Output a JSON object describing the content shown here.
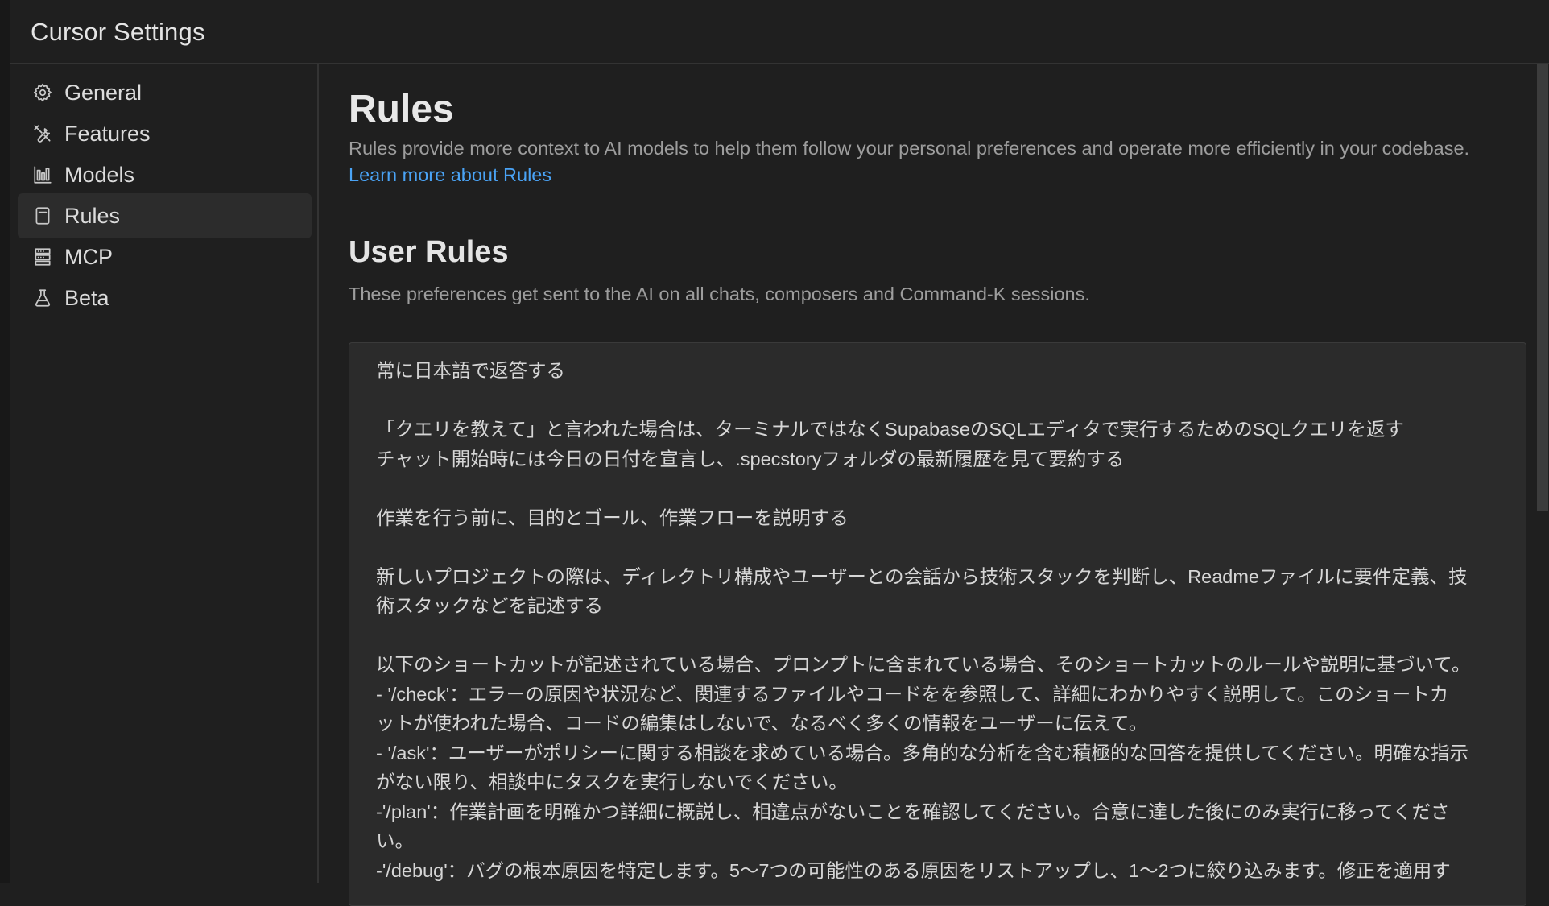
{
  "window": {
    "title": "Cursor Settings"
  },
  "sidebar": {
    "items": [
      {
        "label": "General",
        "icon": "gear-icon"
      },
      {
        "label": "Features",
        "icon": "tools-icon"
      },
      {
        "label": "Models",
        "icon": "bar-chart-icon"
      },
      {
        "label": "Rules",
        "icon": "document-icon",
        "active": true
      },
      {
        "label": "MCP",
        "icon": "server-icon"
      },
      {
        "label": "Beta",
        "icon": "flask-icon"
      }
    ]
  },
  "main": {
    "title": "Rules",
    "description": "Rules provide more context to AI models to help them follow your personal preferences and operate more efficiently in your codebase.",
    "learn_more": "Learn more about Rules",
    "user_rules": {
      "title": "User Rules",
      "description": "These preferences get sent to the AI on all chats, composers and Command-K sessions.",
      "lines": [
        "常に日本語で返答する",
        "",
        "「クエリを教えて」と言われた場合は、ターミナルではなくSupabaseのSQLエディタで実行するためのSQLクエリを返す",
        "チャット開始時には今日の日付を宣言し、.specstoryフォルダの最新履歴を見て要約する",
        "",
        "作業を行う前に、目的とゴール、作業フローを説明する",
        "",
        "新しいプロジェクトの際は、ディレクトリ構成やユーザーとの会話から技術スタックを判断し、Readmeファイルに要件定義、技",
        "術スタックなどを記述する",
        "",
        "以下のショートカットが記述されている場合、プロンプトに含まれている場合、そのショートカットのルールや説明に基づいて。",
        "- '/check'：エラーの原因や状況など、関連するファイルやコードをを参照して、詳細にわかりやすく説明して。このショートカ",
        "ットが使われた場合、コードの編集はしないで、なるべく多くの情報をユーザーに伝えて。",
        "- '/ask'：ユーザーがポリシーに関する相談を求めている場合。多角的な分析を含む積極的な回答を提供してください。明確な指示",
        "がない限り、相談中にタスクを実行しないでください。",
        "-'/plan'：作業計画を明確かつ詳細に概説し、相違点がないことを確認してください。合意に達した後にのみ実行に移ってくださ",
        "い。",
        "-'/debug'：バグの根本原因を特定します。5〜7つの可能性のある原因をリストアップし、1〜2つに絞り込みます。修正を適用す"
      ]
    }
  }
}
